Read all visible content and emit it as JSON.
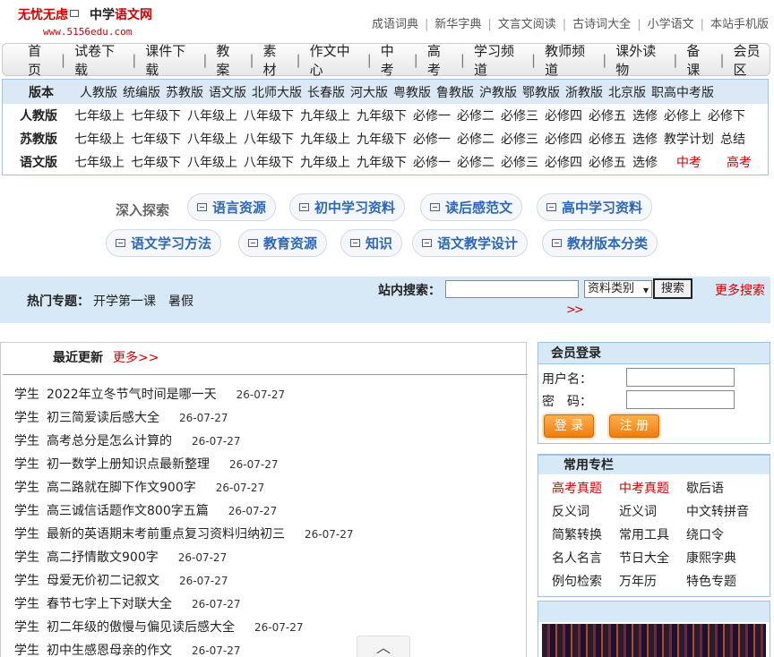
{
  "logo": {
    "name1": "无忧无虑",
    "name2a": "中学",
    "name2b": "语文网",
    "url": "www.5156edu.com"
  },
  "toplinks": [
    "成语词典",
    "新华字典",
    "文言文阅读",
    "古诗词大全",
    "小学语文",
    "本站手机版"
  ],
  "nav": [
    "首页",
    "试卷下载",
    "课件下载",
    "教案",
    "素材",
    "作文中心",
    "中考",
    "高考",
    "学习频道",
    "教师频道",
    "课外读物",
    "备课",
    "会员区"
  ],
  "versions": {
    "label": "版本",
    "items": [
      "人教版",
      "统编版",
      "苏教版",
      "语文版",
      "北师大版",
      "长春版",
      "河大版",
      "粤教版",
      "鲁教版",
      "沪教版",
      "鄂教版",
      "浙教版",
      "北京版",
      "职高中考版"
    ],
    "rows": [
      {
        "label": "人教版",
        "items": [
          "七年级上",
          "七年级下",
          "八年级上",
          "八年级下",
          "九年级上",
          "九年级下",
          "必修一",
          "必修二",
          "必修三",
          "必修四",
          "必修五",
          "选修",
          "必修上",
          "必修下"
        ]
      },
      {
        "label": "苏教版",
        "items": [
          "七年级上",
          "七年级下",
          "八年级上",
          "八年级下",
          "九年级上",
          "九年级下",
          "必修一",
          "必修二",
          "必修三",
          "必修四",
          "必修五",
          "选修",
          "教学计划",
          "总结"
        ]
      },
      {
        "label": "语文版",
        "items": [
          "七年级上",
          "七年级下",
          "八年级上",
          "八年级下",
          "九年级上",
          "九年级下",
          "必修一",
          "必修二",
          "必修三",
          "必修四",
          "必修五",
          "选修"
        ],
        "red": [
          "中考",
          "高考"
        ]
      }
    ]
  },
  "explore": {
    "label": "深入探索",
    "pills": [
      "语言资源",
      "初中学习资料",
      "读后感范文",
      "高中学习资料",
      "语文学习方法",
      "教育资源",
      "知识",
      "语文教学设计",
      "教材版本分类"
    ]
  },
  "hot": {
    "label": "热门专题：",
    "items": [
      "开学第一课",
      "暑假"
    ]
  },
  "search": {
    "label": "站内搜索：",
    "value": "",
    "select": "资料类别",
    "button": "搜索",
    "more": "更多搜索",
    "chevron": ">>"
  },
  "latest": {
    "title": "最近更新",
    "more": "更多>>",
    "items": [
      {
        "tag": "学生",
        "title": "2022年立冬节气时间是哪一天",
        "date": "26-07-27"
      },
      {
        "tag": "学生",
        "title": "初三简爱读后感大全",
        "date": "26-07-27"
      },
      {
        "tag": "学生",
        "title": "高考总分是怎么计算的",
        "date": "26-07-27"
      },
      {
        "tag": "学生",
        "title": "初一数学上册知识点最新整理",
        "date": "26-07-27"
      },
      {
        "tag": "学生",
        "title": "高二路就在脚下作文900字",
        "date": "26-07-27"
      },
      {
        "tag": "学生",
        "title": "高三诚信话题作文800字五篇",
        "date": "26-07-27"
      },
      {
        "tag": "学生",
        "title": "最新的英语期末考前重点复习资料归纳初三",
        "date": "26-07-27"
      },
      {
        "tag": "学生",
        "title": "高二抒情散文900字",
        "date": "26-07-27"
      },
      {
        "tag": "学生",
        "title": "母爱无价初二记叙文",
        "date": "26-07-27"
      },
      {
        "tag": "学生",
        "title": "春节七字上下对联大全",
        "date": "26-07-27"
      },
      {
        "tag": "学生",
        "title": "初二年级的傲慢与偏见读后感大全",
        "date": "26-07-27"
      },
      {
        "tag": "学生",
        "title": "初中生感恩母亲的作文",
        "date": "26-07-27"
      }
    ]
  },
  "login": {
    "title": "会员登录",
    "user_label": "用户名：",
    "pass_label": "密　码：",
    "login_button": "登 录",
    "register_button": "注 册"
  },
  "tools": {
    "title": "常用专栏",
    "items": [
      "高考真题",
      "中考真题",
      "歇后语",
      "反义词",
      "近义词",
      "中文转拼音",
      "简繁转换",
      "常用工具",
      "绕口令",
      "名人名言",
      "节日大全",
      "康熙字典",
      "例句检索",
      "万年历",
      "特色专题"
    ],
    "red_count": 2
  }
}
